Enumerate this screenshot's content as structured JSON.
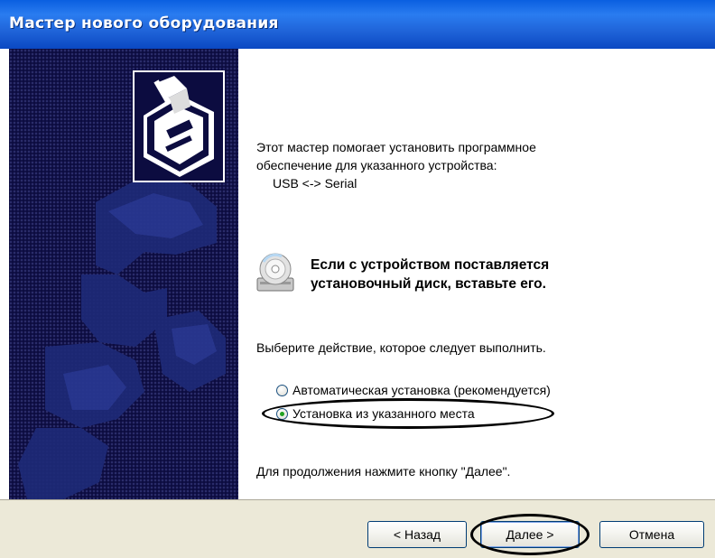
{
  "window": {
    "title": "Мастер нового оборудования"
  },
  "content": {
    "intro_line1": "Этот мастер помогает установить программное",
    "intro_line2": "обеспечение для указанного устройства:",
    "device_name": "USB <-> Serial",
    "cd_prompt_line1": "Если с устройством поставляется",
    "cd_prompt_line2": "установочный диск, вставьте его.",
    "choose_action": "Выберите действие, которое следует выполнить.",
    "options": [
      {
        "label": "Автоматическая установка (рекомендуется)",
        "selected": false
      },
      {
        "label": "Установка из указанного места",
        "selected": true
      }
    ],
    "continue_hint": "Для продолжения нажмите кнопку \"Далее\"."
  },
  "buttons": {
    "back": "< Назад",
    "next": "Далее >",
    "cancel": "Отмена"
  },
  "icons": {
    "hardware": "hardware-install-icon",
    "cd": "cd-drive-icon"
  },
  "colors": {
    "titlebar": "#1f63d8",
    "side_panel": "#0c0c40",
    "footer": "#ece9d8",
    "radio_dot": "#21a121"
  }
}
